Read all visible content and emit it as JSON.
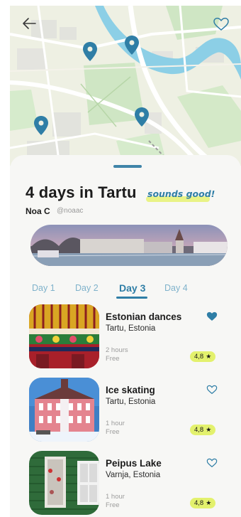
{
  "map": {
    "back_icon": "arrow-left-icon",
    "favorite_icon": "heart-outline-icon",
    "pin_color": "#2f7ea6",
    "pin_icon": "map-pin-icon"
  },
  "trip": {
    "title": "4 days in Tartu",
    "tagline": "sounds good!",
    "author": "Noa C",
    "author_handle": "@noaac"
  },
  "tabs": [
    {
      "label": "Day 1",
      "active": false
    },
    {
      "label": "Day 2",
      "active": false
    },
    {
      "label": "Day 3",
      "active": true
    },
    {
      "label": "Day 4",
      "active": false
    }
  ],
  "activities": [
    {
      "name": "Estonian dances",
      "location": "Tartu, Estonia",
      "duration": "2 hours",
      "price": "Free",
      "rating": "4,8",
      "favorited": true,
      "heart_icon": "heart-filled-icon"
    },
    {
      "name": "Ice skating",
      "location": "Tartu, Estonia",
      "duration": "1 hour",
      "price": "Free",
      "rating": "4,8",
      "favorited": false,
      "heart_icon": "heart-outline-icon"
    },
    {
      "name": "Peipus Lake",
      "location": "Varnja, Estonia",
      "duration": "1 hour",
      "price": "Free",
      "rating": "4,8",
      "favorited": false,
      "heart_icon": "heart-outline-icon"
    }
  ],
  "rating_icon": "star-icon",
  "colors": {
    "accent": "#2f7ea6",
    "highlight": "#e3f16d",
    "sheet": "#f7f7f5"
  }
}
